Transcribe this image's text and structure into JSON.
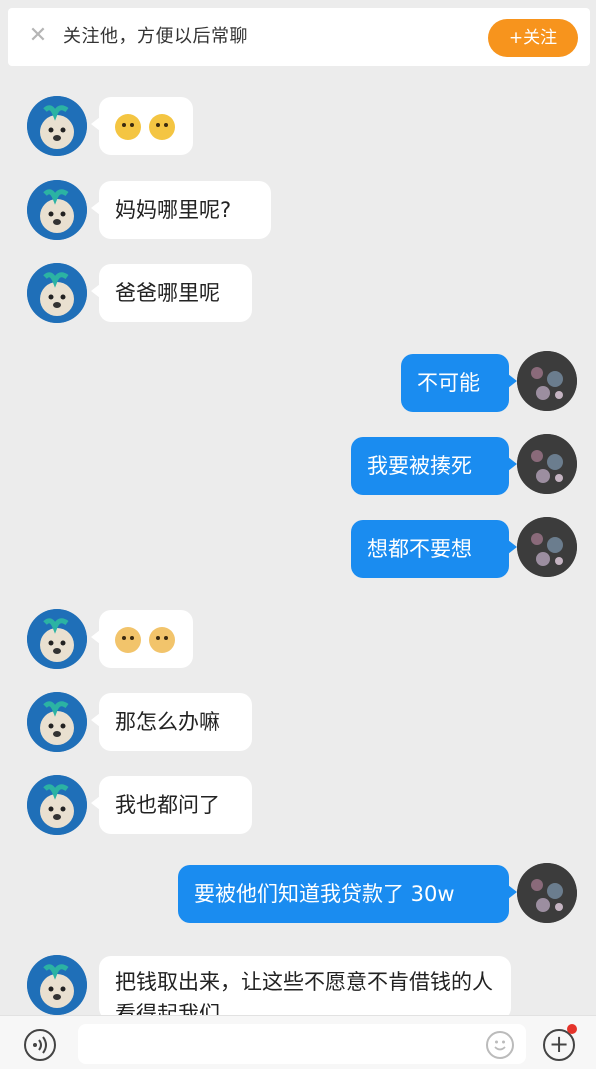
{
  "banner": {
    "close_icon": "✕",
    "text": "关注他，方便以后常聊",
    "follow_label": "+关注"
  },
  "messages": [
    {
      "side": "left",
      "type": "emoji",
      "emoji": "cry"
    },
    {
      "side": "left",
      "type": "text",
      "text": "妈妈哪里呢?"
    },
    {
      "side": "left",
      "type": "text",
      "text": "爸爸哪里呢"
    },
    {
      "side": "right",
      "type": "text",
      "text": "不可能"
    },
    {
      "side": "right",
      "type": "text",
      "text": "我要被揍死"
    },
    {
      "side": "right",
      "type": "text",
      "text": "想都不要想"
    },
    {
      "side": "left",
      "type": "emoji",
      "emoji": "dog"
    },
    {
      "side": "left",
      "type": "text",
      "text": "那怎么办嘛"
    },
    {
      "side": "left",
      "type": "text",
      "text": "我也都问了"
    },
    {
      "side": "right",
      "type": "text",
      "text": "要被他们知道我贷款了 30w"
    },
    {
      "side": "left",
      "type": "text",
      "text": "把钱取出来，让这些不愿意不肯借钱的人看得起我们"
    }
  ],
  "inputbar": {
    "voice_icon": "voice-icon",
    "emoji_icon": "smile-icon",
    "plus_icon": "plus-icon",
    "notification_color": "#e5332a"
  },
  "colors": {
    "accent": "#1a8cf0",
    "follow": "#f7941d",
    "background": "#ececec"
  }
}
